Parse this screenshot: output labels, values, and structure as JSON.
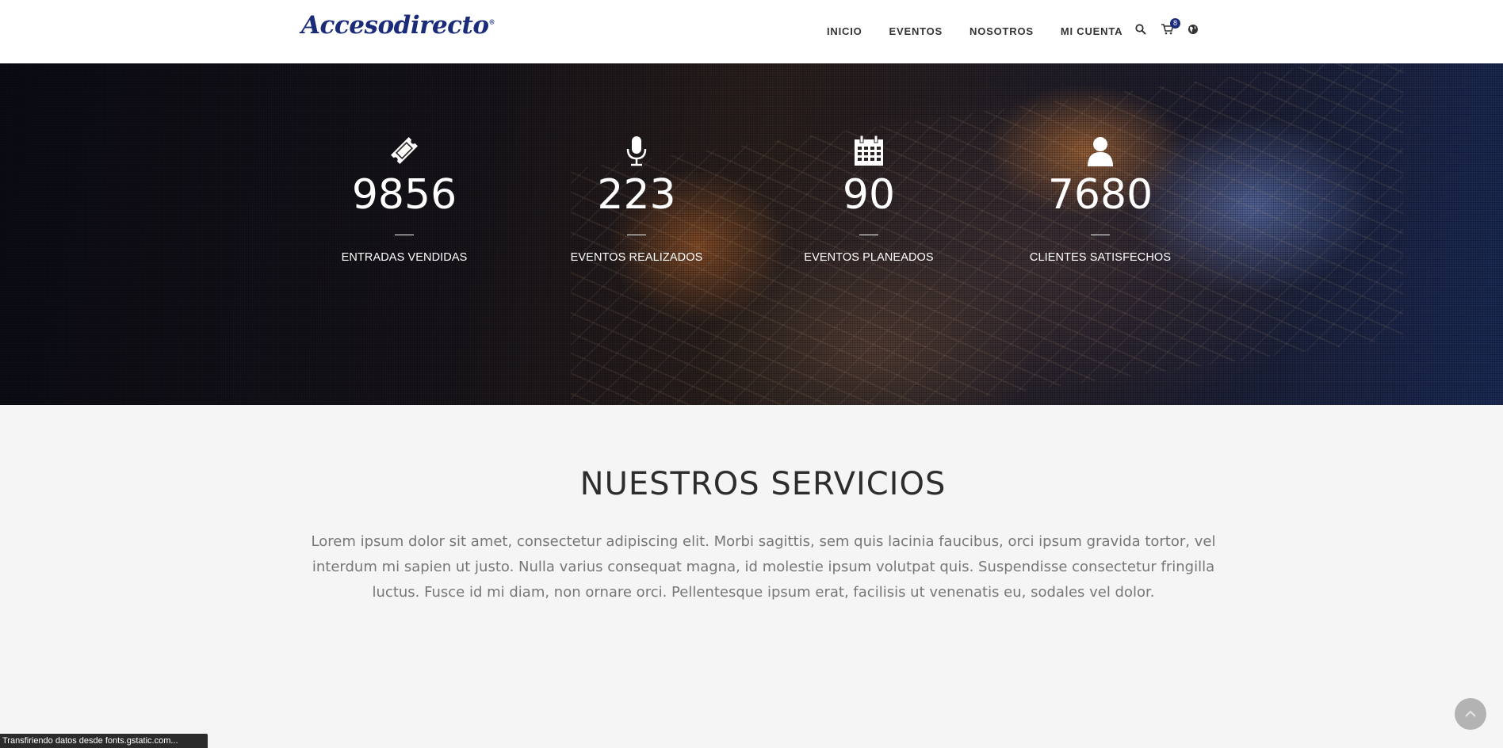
{
  "header": {
    "logo_text": "Accesodirecto",
    "logo_mark": "®",
    "nav": [
      {
        "label": "INICIO"
      },
      {
        "label": "EVENTOS"
      },
      {
        "label": "NOSOTROS"
      },
      {
        "label": "MI CUENTA"
      }
    ],
    "icons": {
      "search": "search-icon",
      "cart": "cart-icon",
      "language": "globe-icon"
    },
    "cart_count": "8"
  },
  "stats": [
    {
      "icon": "ticket-icon",
      "number": "9856",
      "label": "ENTRADAS VENDIDAS"
    },
    {
      "icon": "microphone-icon",
      "number": "223",
      "label": "EVENTOS REALIZADOS"
    },
    {
      "icon": "calendar-icon",
      "number": "90",
      "label": "EVENTOS PLANEADOS"
    },
    {
      "icon": "user-icon",
      "number": "7680",
      "label": "CLIENTES SATISFECHOS"
    }
  ],
  "services": {
    "title": "NUESTROS SERVICIOS",
    "text": "Lorem ipsum dolor sit amet, consectetur adipiscing elit. Morbi sagittis, sem quis lacinia faucibus, orci ipsum gravida tortor, vel interdum mi sapien ut justo. Nulla varius consequat magna, id molestie ipsum volutpat quis. Suspendisse consectetur fringilla luctus. Fusce id mi diam, non ornare orci. Pellentesque ipsum erat, facilisis ut venenatis eu, sodales vel dolor."
  },
  "status_bar": "Transfiriendo datos desde fonts.gstatic.com...",
  "colors": {
    "brand": "#1a2b7a",
    "scroll_top": "#b3b3b3"
  }
}
